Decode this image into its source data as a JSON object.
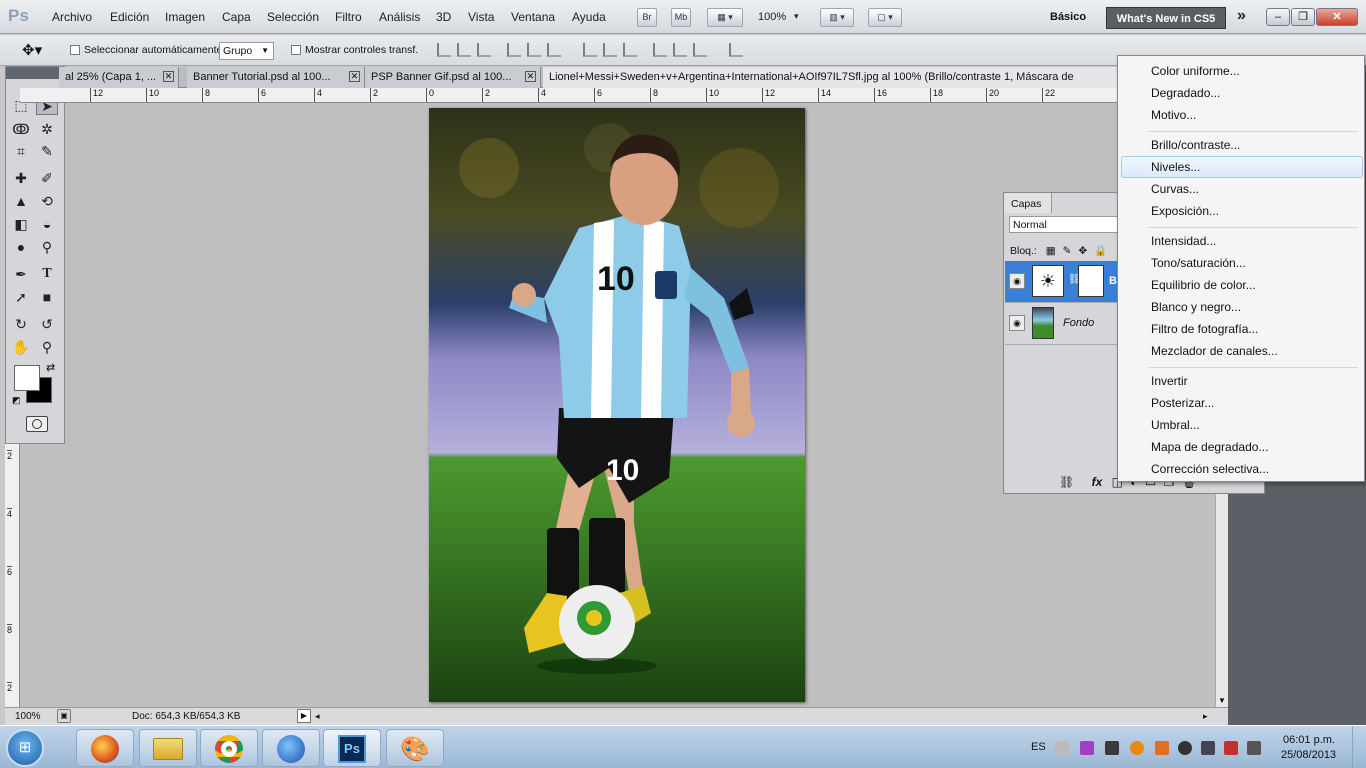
{
  "app": {
    "logo": "Ps"
  },
  "menubar": {
    "items": [
      "Archivo",
      "Edición",
      "Imagen",
      "Capa",
      "Selección",
      "Filtro",
      "Análisis",
      "3D",
      "Vista",
      "Ventana",
      "Ayuda"
    ],
    "bridge": "Br",
    "minibridge": "Mb",
    "zoom": "100%",
    "workspace": "Básico",
    "whats_new": "What's New in CS5",
    "more": "»"
  },
  "options": {
    "auto_select_label": "Seleccionar automáticamente:",
    "auto_select_value": "Grupo",
    "show_transform_label": "Mostrar controles transf."
  },
  "tabs": [
    {
      "label": "al 25% (Capa 1, ..."
    },
    {
      "label": "Banner Tutorial.psd al 100..."
    },
    {
      "label": "PSP Banner Gif.psd al 100..."
    },
    {
      "label": "Lionel+Messi+Sweden+v+Argentina+International+AOIf97IL7Sfl.jpg al 100% (Brillo/contraste 1, Máscara de"
    }
  ],
  "ruler": {
    "h_labels": [
      "12",
      "10",
      "8",
      "6",
      "4",
      "2",
      "0",
      "2",
      "4",
      "6",
      "8",
      "10",
      "12",
      "14",
      "16",
      "18",
      "20",
      "22"
    ],
    "v_labels": [
      "2",
      "4",
      "6",
      "8",
      "2"
    ]
  },
  "status": {
    "zoom": "100%",
    "doc": "Doc: 654,3 KB/654,3 KB"
  },
  "layers": {
    "tab": "Capas",
    "blend_mode": "Normal",
    "lock_label": "Bloq.:",
    "items": [
      {
        "name": "B"
      },
      {
        "name": "Fondo"
      }
    ]
  },
  "context_menu": {
    "groups": [
      [
        "Color uniforme...",
        "Degradado...",
        "Motivo..."
      ],
      [
        "Brillo/contraste...",
        "Niveles...",
        "Curvas...",
        "Exposición..."
      ],
      [
        "Intensidad...",
        "Tono/saturación...",
        "Equilibrio de color...",
        "Blanco y negro...",
        "Filtro de fotografía...",
        "Mezclador de canales..."
      ],
      [
        "Invertir",
        "Posterizar...",
        "Umbral...",
        "Mapa de degradado...",
        "Corrección selectiva..."
      ]
    ],
    "highlighted": "Niveles..."
  },
  "taskbar": {
    "lang": "ES",
    "time": "06:01 p.m.",
    "date": "25/08/2013",
    "ps_label": "Ps"
  },
  "photo": {
    "shirt_number": "10",
    "shorts_number": "10"
  }
}
